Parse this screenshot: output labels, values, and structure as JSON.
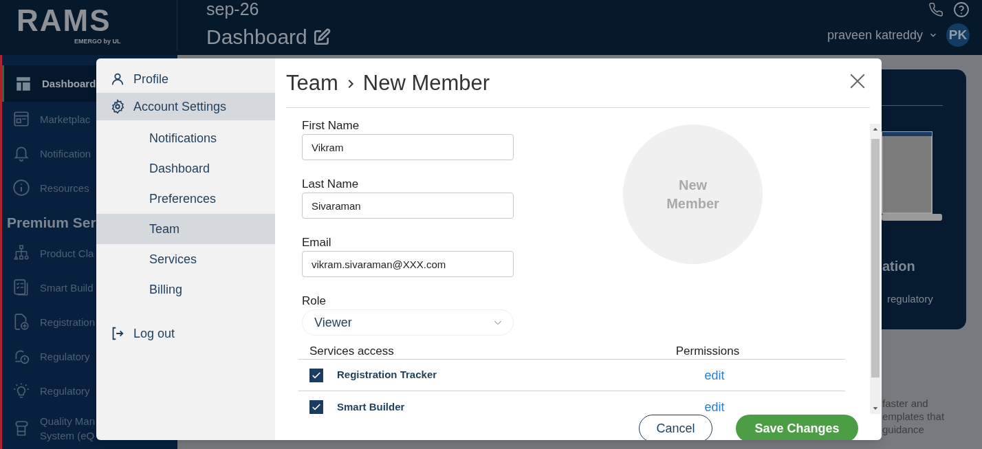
{
  "header": {
    "logo": "RAMS",
    "logo_subtitle": "EMERGO by UL",
    "date": "sep-26",
    "page_title": "Dashboard",
    "user_name": "praveen katreddy",
    "avatar_initials": "PK"
  },
  "sidebar": {
    "items": [
      {
        "label": "Dashboard",
        "kind": "item",
        "selected": true
      },
      {
        "label": "Marketplac",
        "kind": "item",
        "selected": false
      },
      {
        "label": "Notification",
        "kind": "item",
        "selected": false
      },
      {
        "label": "Resources",
        "kind": "item",
        "selected": false
      },
      {
        "label": "Premium Ser",
        "kind": "heading"
      },
      {
        "label": "Product Cla",
        "kind": "item",
        "selected": false
      },
      {
        "label": "Smart Build",
        "kind": "item",
        "selected": false
      },
      {
        "label": "Registration",
        "kind": "item",
        "selected": false
      },
      {
        "label": "Regulatory",
        "kind": "item",
        "selected": false
      },
      {
        "label": "Regulatory",
        "kind": "item",
        "selected": false
      },
      {
        "label": "Quality Man System (eQ",
        "kind": "item",
        "selected": false
      }
    ]
  },
  "background_card": {
    "title": "ation",
    "subtitle": "regulatory",
    "lines": [
      "faster and",
      "emplates that",
      "guidance"
    ]
  },
  "modal": {
    "menu": [
      {
        "label": "Profile",
        "kind": "top",
        "selected": false
      },
      {
        "label": "Account Settings",
        "kind": "top",
        "selected": true,
        "children": [
          {
            "label": "Notifications",
            "selected": false
          },
          {
            "label": "Dashboard",
            "selected": false
          },
          {
            "label": "Preferences",
            "selected": false
          },
          {
            "label": "Team",
            "selected": true
          },
          {
            "label": "Services",
            "selected": false
          },
          {
            "label": "Billing",
            "selected": false
          }
        ]
      },
      {
        "label": "Log out",
        "kind": "logout",
        "selected": false
      }
    ],
    "breadcrumb": [
      "Team",
      "New Member"
    ],
    "fields": [
      {
        "label": "First Name",
        "value": "Vikram"
      },
      {
        "label": "Last Name",
        "value": "Sivaraman"
      },
      {
        "label": "Email",
        "value": "vikram.sivaraman@XXX.com"
      }
    ],
    "avatar_placeholder": "New Member",
    "role": {
      "label": "Role",
      "value": "Viewer"
    },
    "services": {
      "columns": [
        "Services access",
        "Permissions"
      ],
      "rows": [
        {
          "name": "Registration Tracker",
          "checked": true,
          "action": "edit"
        },
        {
          "name": "Smart Builder",
          "checked": true,
          "action": "edit"
        }
      ]
    },
    "buttons": [
      {
        "label": "Cancel",
        "kind": "secondary"
      },
      {
        "label": "Save Changes",
        "kind": "primary"
      }
    ]
  }
}
